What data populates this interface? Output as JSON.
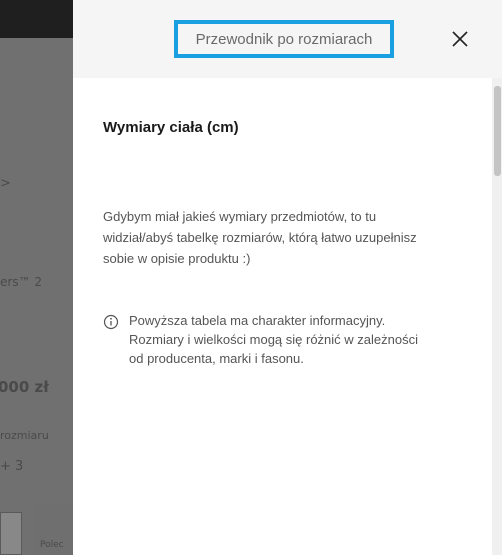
{
  "drawer": {
    "title": "Przewodnik po rozmiarach",
    "close_label": "close",
    "section_heading": "Wymiary ciała (cm)",
    "description": "Gdybym miał jakieś wymiary przedmiotów, to tu widział/abyś tabelkę rozmiarów, którą łatwo uzupełnisz sobie w opisie produktu :)",
    "info_text": "Powyższa tabela ma charakter informacyjny. Rozmiary i wielkości mogą się różnić w zależności od producenta, marki i fasonu."
  },
  "background": {
    "fragment_1": ">",
    "fragment_2": "ers™ 2",
    "fragment_3": "000 zł",
    "fragment_4": "rozmiaru",
    "fragment_5": "+ 3",
    "fragment_6": "Polec"
  },
  "colors": {
    "accent_border": "#1aa0e0",
    "overlay": "#707070",
    "header_bg": "#f5f5f5"
  },
  "icons": {
    "close": "close-icon",
    "info": "info-icon"
  }
}
